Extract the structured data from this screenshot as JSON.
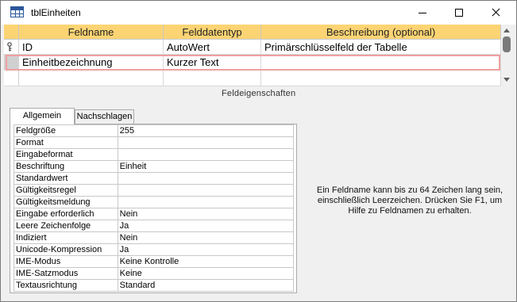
{
  "window": {
    "title": "tblEinheiten"
  },
  "grid": {
    "headers": [
      "Feldname",
      "Felddatentyp",
      "Beschreibung (optional)"
    ],
    "rows": [
      {
        "field_name": "ID",
        "data_type": "AutoWert",
        "description": "Primärschlüsselfeld der Tabelle",
        "primary_key": true
      },
      {
        "field_name": "Einheitbezeichnung",
        "data_type": "Kurzer Text",
        "description": "",
        "selected": true
      },
      {
        "field_name": "",
        "data_type": "",
        "description": ""
      }
    ]
  },
  "field_properties": {
    "section_label": "Feldeigenschaften",
    "tabs": [
      "Allgemein",
      "Nachschlagen"
    ],
    "active_tab": "Allgemein",
    "properties": [
      {
        "name": "Feldgröße",
        "value": "255"
      },
      {
        "name": "Format",
        "value": ""
      },
      {
        "name": "Eingabeformat",
        "value": ""
      },
      {
        "name": "Beschriftung",
        "value": "Einheit"
      },
      {
        "name": "Standardwert",
        "value": ""
      },
      {
        "name": "Gültigkeitsregel",
        "value": ""
      },
      {
        "name": "Gültigkeitsmeldung",
        "value": ""
      },
      {
        "name": "Eingabe erforderlich",
        "value": "Nein"
      },
      {
        "name": "Leere Zeichenfolge",
        "value": "Ja"
      },
      {
        "name": "Indiziert",
        "value": "Nein"
      },
      {
        "name": "Unicode-Kompression",
        "value": "Ja"
      },
      {
        "name": "IME-Modus",
        "value": "Keine Kontrolle"
      },
      {
        "name": "IME-Satzmodus",
        "value": "Keine"
      },
      {
        "name": "Textausrichtung",
        "value": "Standard"
      }
    ],
    "help_text": "Ein Feldname kann bis zu 64 Zeichen lang sein, einschließlich Leerzeichen. Drücken Sie F1, um Hilfe zu Feldnamen zu erhalten."
  },
  "colors": {
    "header_bg": "#fdd473",
    "selection_border": "#f0a0a0",
    "accent": "#2b579a"
  }
}
